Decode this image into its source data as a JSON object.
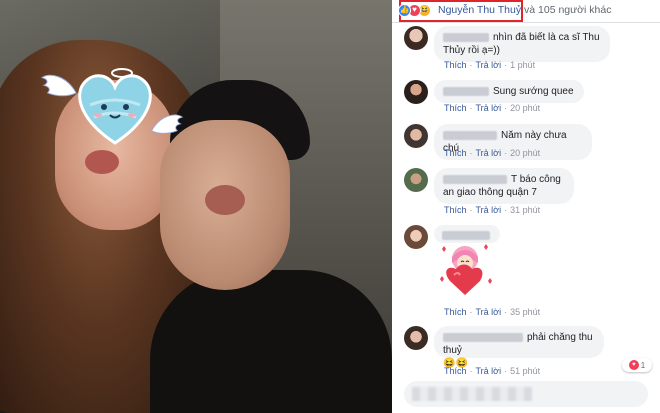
{
  "reactions": {
    "icons": [
      "like-icon",
      "love-icon",
      "haha-icon"
    ],
    "highlighted_name": "Nguyễn Thu Thuỷ",
    "rest": " và 105 người khác"
  },
  "labels": {
    "like": "Thích",
    "reply": "Trả lời",
    "dot": "·"
  },
  "comments": [
    {
      "text": "nhìn đã biết là ca sĩ Thu Thủy rồi ạ=))",
      "time": "1 phút"
    },
    {
      "text": "Sung sướng quee",
      "time": "20 phút"
    },
    {
      "text": "Năm này chưa chú",
      "time": "20 phút"
    },
    {
      "text": "T báo công an giao thông quận 7",
      "time": "31 phút"
    },
    {
      "text": "",
      "time": "35 phút"
    },
    {
      "text": "phải chăng thu thuỷ",
      "emoji": "😆😆",
      "time": "51 phút",
      "reaction_count": "1"
    }
  ],
  "colors": {
    "link": "#385898",
    "highlight": "#e0242b",
    "bubble": "#f2f3f5"
  }
}
